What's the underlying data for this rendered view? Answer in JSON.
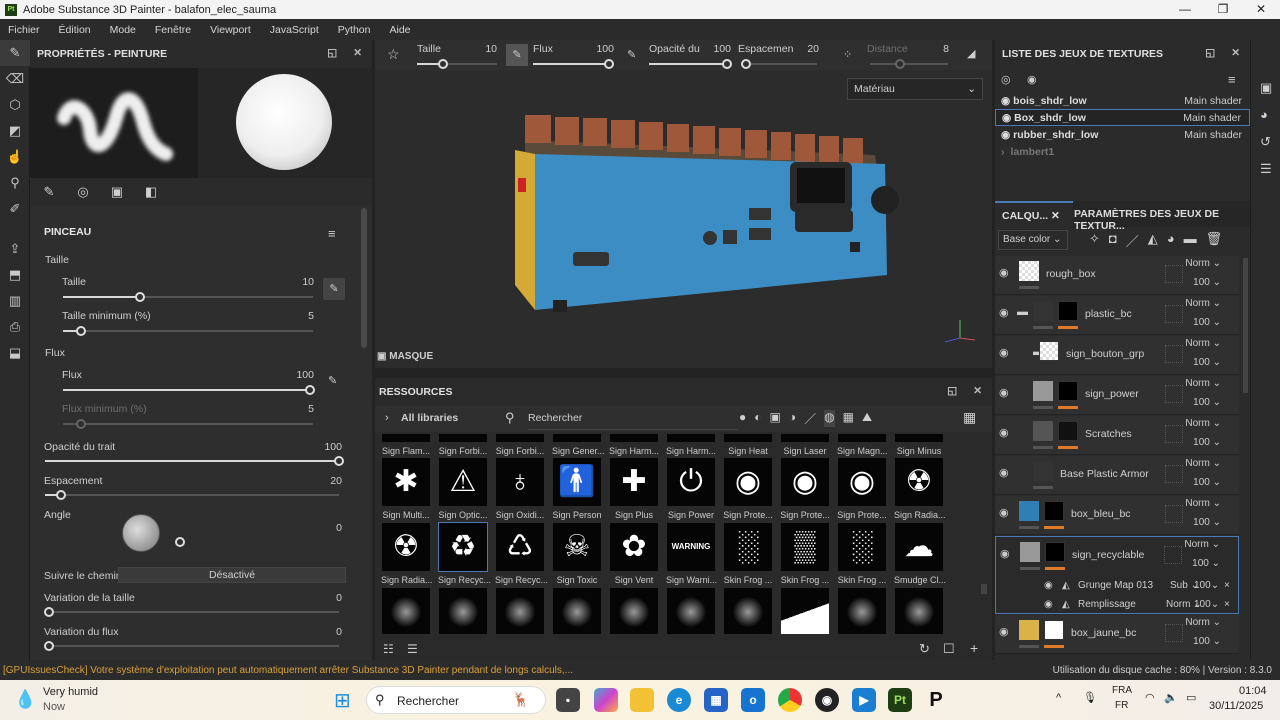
{
  "window": {
    "title": "Adobe Substance 3D Painter - balafon_elec_sauma",
    "min": "—",
    "max": "❐",
    "close": "✕",
    "logo": "Pt"
  },
  "menu": [
    "Fichier",
    "Édition",
    "Mode",
    "Fenêtre",
    "Viewport",
    "JavaScript",
    "Python",
    "Aide"
  ],
  "left_panel": {
    "title": "PROPRIÉTÉS - PEINTURE",
    "section": "PINCEAU",
    "taille_group": "Taille",
    "taille": {
      "label": "Taille",
      "value": "10",
      "fraction": 0.25
    },
    "taille_min": {
      "label": "Taille minimum (%)",
      "value": "5",
      "fraction": 0.05
    },
    "flux_group": "Flux",
    "flux": {
      "label": "Flux",
      "value": "100",
      "fraction": 1.0
    },
    "flux_min": {
      "label": "Flux minimum (%)",
      "value": "5"
    },
    "opacite": {
      "label": "Opacité du trait",
      "value": "100",
      "fraction": 1.0
    },
    "espacement": {
      "label": "Espacement",
      "value": "20",
      "fraction": 0.05
    },
    "angle": {
      "label": "Angle",
      "value": "0"
    },
    "suivre": {
      "label": "Suivre le chemin",
      "value": "Désactivé"
    },
    "var_taille": {
      "label": "Variation de la taille",
      "value": "0"
    },
    "var_flux": {
      "label": "Variation du flux",
      "value": "0"
    }
  },
  "toolbar": {
    "taille": {
      "label": "Taille",
      "value": "10"
    },
    "flux": {
      "label": "Flux",
      "value": "100"
    },
    "opacite": {
      "label": "Opacité du",
      "value": "100"
    },
    "espacement": {
      "label": "Espacemen",
      "value": "20"
    },
    "distance": {
      "label": "Distance",
      "value": "8"
    }
  },
  "viewport": {
    "mode": "Matériau",
    "mask_label": "MASQUE"
  },
  "resources": {
    "title": "RESSOURCES",
    "libraries": "All libraries",
    "search_placeholder": "Rechercher",
    "assets": [
      [
        "Sign Flam...",
        "Sign Forbi...",
        "Sign Forbi...",
        "Sign Gener...",
        "Sign Harm...",
        "Sign Harm...",
        "Sign Heat",
        "Sign Laser",
        "Sign Magn...",
        "Sign Minus"
      ],
      [
        "Sign Multi...",
        "Sign Optic...",
        "Sign Oxidi...",
        "Sign Person",
        "Sign Plus",
        "Sign Power",
        "Sign Prote...",
        "Sign Prote...",
        "Sign Prote...",
        "Sign Radia..."
      ],
      [
        "Sign Radia...",
        "Sign Recyc...",
        "Sign Recyc...",
        "Sign Toxic",
        "Sign Vent",
        "Sign Warni...",
        "Skin Frog ...",
        "Skin Frog ...",
        "Skin Frog ...",
        "Smudge Cl..."
      ]
    ],
    "glyphs": [
      [
        "!",
        "⊘",
        "●",
        "⚠",
        "✕",
        "✖",
        "♨",
        "✷",
        "⚠",
        ""
      ],
      [
        "✱",
        "⚠",
        "♁",
        "🚹",
        "✚",
        "⏻",
        "◉",
        "◉",
        "◉",
        "☢"
      ],
      [
        "☢",
        "♻",
        "♺",
        "☠",
        "✿",
        "WARNING",
        "░",
        "▒",
        "░",
        "☁"
      ]
    ]
  },
  "texture_sets": {
    "title": "LISTE DES JEUX DE TEXTURES",
    "items": [
      {
        "name": "bois_shdr_low",
        "shader": "Main shader"
      },
      {
        "name": "Box_shdr_low",
        "shader": "Main shader",
        "selected": true
      },
      {
        "name": "rubber_shdr_low",
        "shader": "Main shader"
      }
    ],
    "collapsed": "lambert1"
  },
  "layers": {
    "tab": "CALQU...",
    "tab2": "PARAMÈTRES DES JEUX DE TEXTUR...",
    "channel": "Base color",
    "items": [
      {
        "name": "rough_box",
        "mode": "Norm",
        "opacity": "100"
      },
      {
        "name": "plastic_bc",
        "mode": "Norm",
        "opacity": "100"
      },
      {
        "name": "sign_bouton_grp",
        "mode": "Norm",
        "opacity": "100"
      },
      {
        "name": "sign_power",
        "mode": "Norm",
        "opacity": "100"
      },
      {
        "name": "Scratches",
        "mode": "Norm",
        "opacity": "100"
      },
      {
        "name": "Base Plastic Armor",
        "mode": "Norm",
        "opacity": "100"
      },
      {
        "name": "box_bleu_bc",
        "mode": "Norm",
        "opacity": "100"
      },
      {
        "name": "sign_recyclable",
        "mode": "Norm",
        "opacity": "100"
      },
      {
        "name": "box_jaune_bc",
        "mode": "Norm",
        "opacity": "100"
      }
    ],
    "effects": [
      {
        "name": "Grunge Map 013",
        "mode": "Sub",
        "opacity": "100"
      },
      {
        "name": "Remplissage",
        "mode": "Norm",
        "opacity": "100"
      }
    ]
  },
  "status": {
    "message": "[GPUIssuesCheck] Votre système d'exploitation peut automatiquement arrêter Substance 3D Painter pendant de longs calculs,...",
    "cache": "Utilisation du disque cache :  80% | Version : 8.3.0"
  },
  "taskbar": {
    "weather_title": "Very humid",
    "weather_sub": "Now",
    "search": "Rechercher",
    "lang1": "FRA",
    "lang2": "FR",
    "time": "01:04",
    "date": "30/11/2025"
  },
  "colors": {
    "accent": "#4a7ab5",
    "orange": "#e07b2a",
    "blue_box": "#2f7fb5",
    "yellow_box": "#d9b248"
  }
}
